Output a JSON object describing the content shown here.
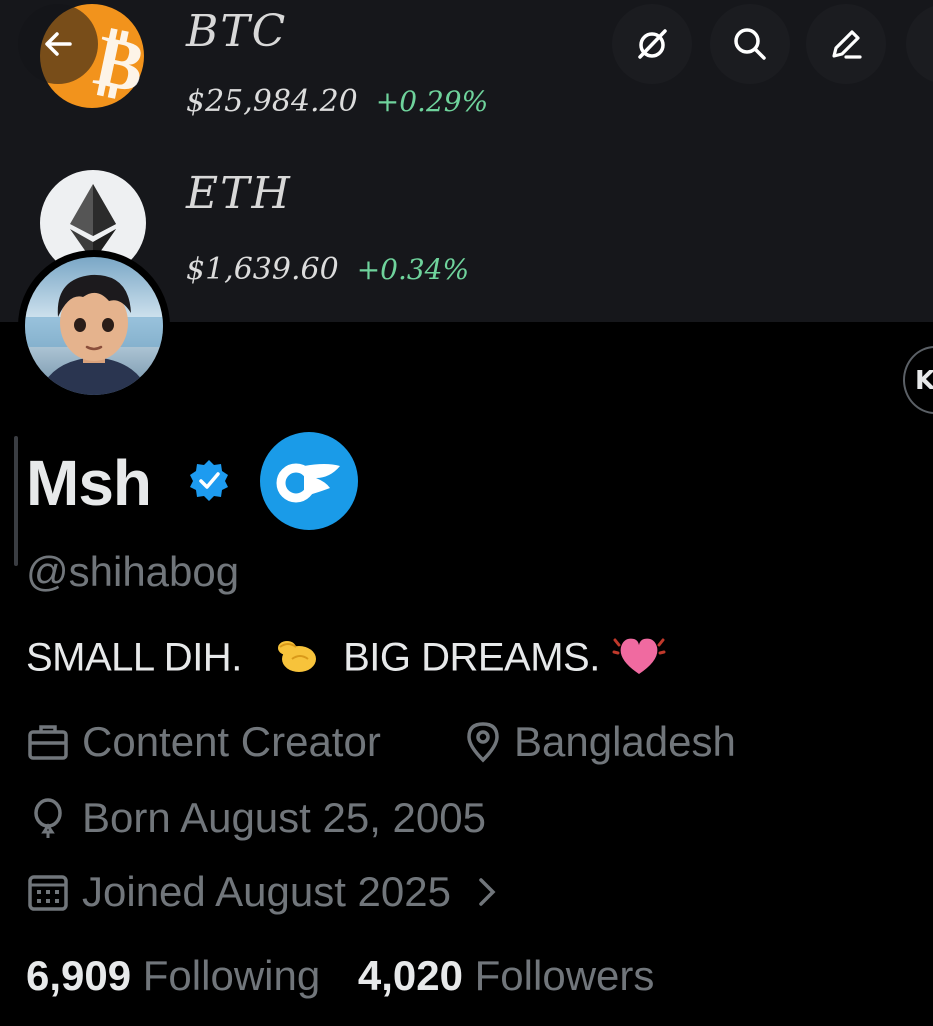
{
  "banner": {
    "btc": {
      "name": "BTC",
      "price": "$25,984.20",
      "change": "+0.29%"
    },
    "eth": {
      "name": "ETH",
      "price": "$1,639.60",
      "change": "+0.34%"
    },
    "side_chip_glyph": "K"
  },
  "header_icons": [
    "back-arrow-icon",
    "grok-icon",
    "search-icon",
    "edit-icon"
  ],
  "profile": {
    "name": "Msh",
    "handle": "@shihabog",
    "bio_text_1": "SMALL DIH.",
    "bio_text_2": "BIG DREAMS.",
    "profession": "Content Creator",
    "location": "Bangladesh",
    "birthday": "Born August 25, 2005",
    "joined": "Joined August 2025"
  },
  "stats": {
    "following_count": "6,909",
    "following_label": "Following",
    "followers_count": "4,020",
    "followers_label": "Followers"
  },
  "colors": {
    "background": "#000000",
    "banner": "#16171b",
    "text_primary": "#e7e9ea",
    "text_secondary": "#71767b",
    "verified_blue": "#1d9bf0",
    "positive_green": "#6fd39c",
    "btc_orange": "#f2931c"
  }
}
